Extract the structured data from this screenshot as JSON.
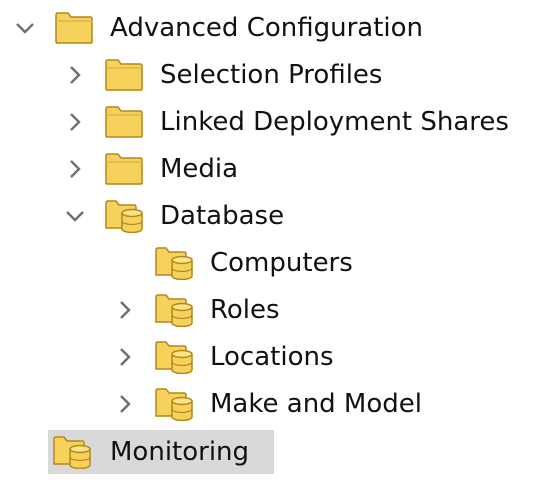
{
  "colors": {
    "chevron": "#707070",
    "folder_fill": "#f6d25c",
    "folder_stroke": "#b2871b",
    "selection": "#d9d9d9"
  },
  "tree": {
    "advanced_configuration": {
      "label": "Advanced Configuration",
      "icon": "folder-icon",
      "expanded": true
    },
    "selection_profiles": {
      "label": "Selection Profiles",
      "icon": "folder-icon",
      "expanded": false
    },
    "linked_deployment_shares": {
      "label": "Linked Deployment Shares",
      "icon": "folder-icon",
      "expanded": false
    },
    "media": {
      "label": "Media",
      "icon": "folder-icon",
      "expanded": false
    },
    "database": {
      "label": "Database",
      "icon": "database-folder-icon",
      "expanded": true
    },
    "computers": {
      "label": "Computers",
      "icon": "database-folder-icon"
    },
    "roles": {
      "label": "Roles",
      "icon": "database-folder-icon",
      "expanded": false
    },
    "locations": {
      "label": "Locations",
      "icon": "database-folder-icon",
      "expanded": false
    },
    "make_and_model": {
      "label": "Make and Model",
      "icon": "database-folder-icon",
      "expanded": false
    },
    "monitoring": {
      "label": "Monitoring",
      "icon": "database-folder-icon",
      "selected": true
    }
  }
}
